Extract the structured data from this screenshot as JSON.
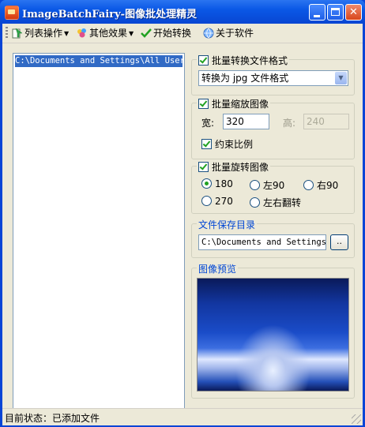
{
  "window": {
    "title": "ImageBatchFairy-图像批处理精灵"
  },
  "toolbar": {
    "items": [
      {
        "label": "列表操作",
        "icon": "list-icon",
        "has_dropdown": true
      },
      {
        "label": "其他效果",
        "icon": "effects-icon",
        "has_dropdown": true
      },
      {
        "label": "开始转换",
        "icon": "checkmark-icon",
        "has_dropdown": false
      },
      {
        "label": "关于软件",
        "icon": "globe-icon",
        "has_dropdown": false
      }
    ]
  },
  "file_list": {
    "items": [
      "C:\\Documents and Settings\\All Users"
    ]
  },
  "format_group": {
    "label": "批量转换文件格式",
    "checked": true,
    "selected_format": "转换为 jpg 文件格式"
  },
  "resize_group": {
    "label": "批量缩放图像",
    "checked": true,
    "width_label": "宽:",
    "width_value": "320",
    "height_label": "高:",
    "height_value": "240",
    "keep_ratio_label": "约束比例",
    "keep_ratio_checked": true
  },
  "rotate_group": {
    "label": "批量旋转图像",
    "checked": true,
    "options": [
      "180",
      "左90",
      "右90",
      "270",
      "左右翻转"
    ],
    "selected": "180"
  },
  "save_group": {
    "label": "文件保存目录",
    "path": "C:\\Documents and Settings\\",
    "browse_label": ".."
  },
  "preview_group": {
    "label": "图像预览"
  },
  "status_bar": {
    "text": "目前状态：已添加文件"
  },
  "colors": {
    "title_bar": "#0a58e6",
    "accent_text": "#0046d5",
    "selection": "#316ac5"
  }
}
